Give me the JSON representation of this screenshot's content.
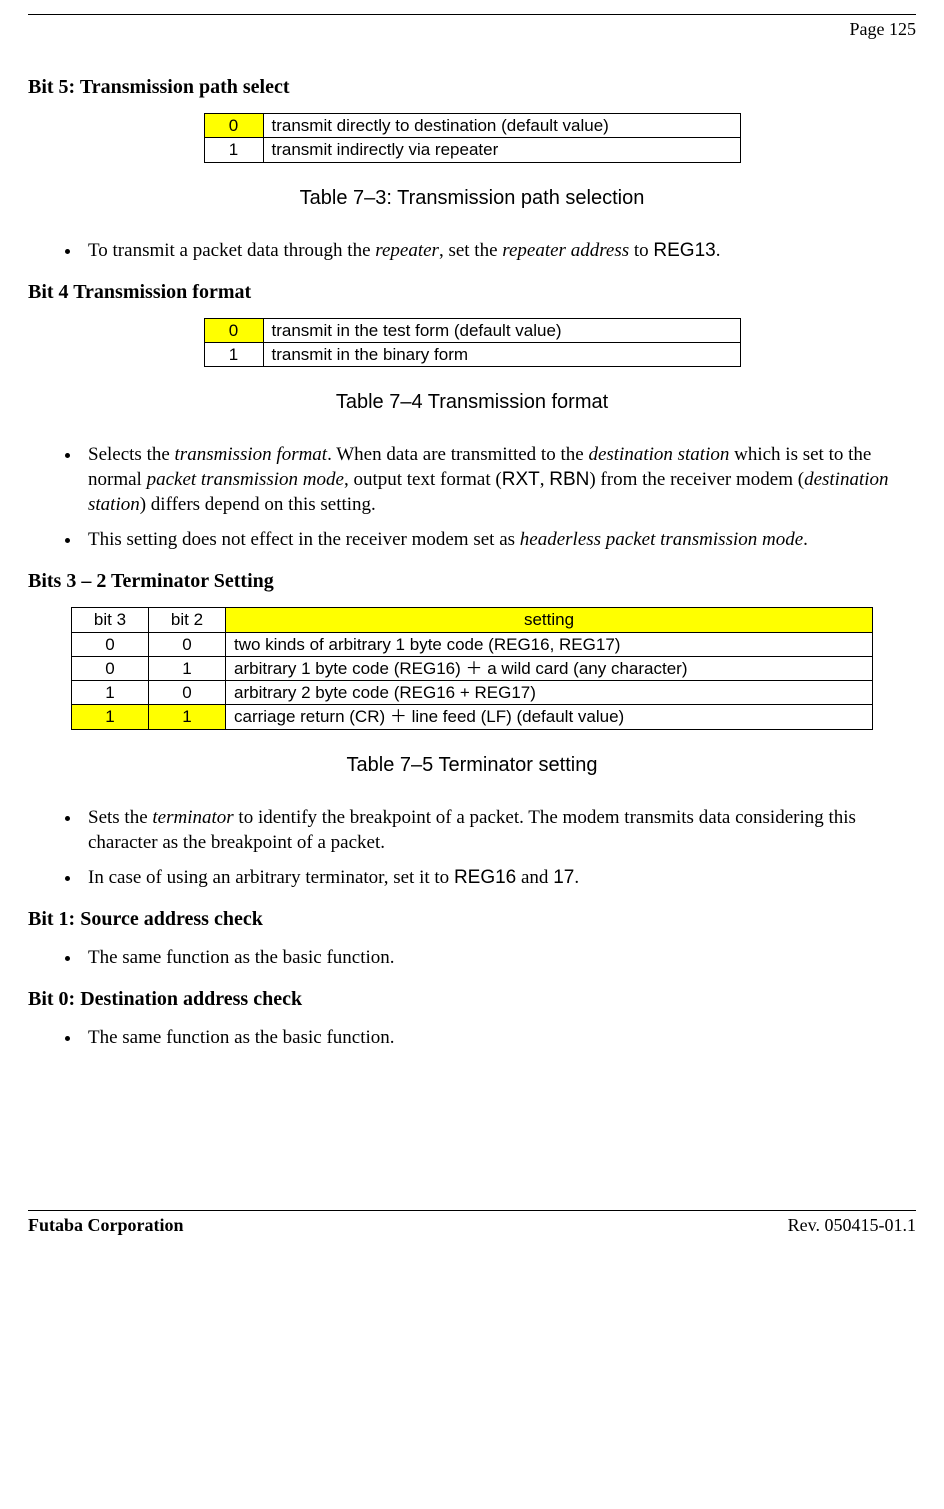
{
  "page_label": "Page  125",
  "bit5": {
    "heading": "Bit 5:  Transmission path select",
    "rows": [
      {
        "v": "0",
        "d": "transmit directly to destination  (default value)",
        "hl": true
      },
      {
        "v": "1",
        "d": "transmit indirectly via repeater",
        "hl": false
      }
    ],
    "caption": "Table 7–3:  Transmission path selection",
    "bullet_pre": "To transmit a packet data through the ",
    "bullet_rep": "repeater",
    "bullet_mid": ", set the ",
    "bullet_ra": "repeater address",
    "bullet_to": " to ",
    "bullet_reg": "REG13",
    "bullet_end": "."
  },
  "bit4": {
    "heading": "Bit 4  Transmission format",
    "rows": [
      {
        "v": "0",
        "d": "transmit  in the test form (default value)",
        "hl": true
      },
      {
        "v": "1",
        "d": "transmit in the binary form",
        "hl": false
      }
    ],
    "caption": "Table 7–4  Transmission format",
    "b1": {
      "t1": "Selects the ",
      "tf": "transmission format",
      "t2": ". When data are transmitted to the ",
      "ds": "destination station",
      "t3": " which is set to the normal ",
      "ptm": "packet transmission mode",
      "t4": ", output text format (",
      "rxt": "RXT",
      "t5": ", ",
      "rbn": "RBN",
      "t6": ") from the receiver modem (",
      "ds2": "destination station",
      "t7": ") differs depend on this setting."
    },
    "b2": {
      "t1": "This setting does not effect in the receiver modem set as ",
      "hptm": "headerless packet transmission mode",
      "t2": "."
    }
  },
  "bits32": {
    "heading": "Bits 3 – 2  Terminator Setting",
    "head": {
      "b3": "bit 3",
      "b2": "bit 2",
      "s": "setting"
    },
    "rows": [
      {
        "b3": "0",
        "b2": "0",
        "s": "two kinds of arbitrary 1 byte code (REG16, REG17)",
        "hl": false
      },
      {
        "b3": "0",
        "b2": "1",
        "s": "arbitrary 1 byte code (REG16) ＋ a wild card (any character)",
        "hl": false
      },
      {
        "b3": "1",
        "b2": "0",
        "s": "arbitrary 2 byte code (REG16 + REG17)",
        "hl": false
      },
      {
        "b3": "1",
        "b2": "1",
        "s": "carriage return (CR) ＋ line feed (LF) (default value)",
        "hl": true
      }
    ],
    "caption": "Table 7–5  Terminator setting",
    "b1": {
      "t1": "Sets the ",
      "term": "terminator",
      "t2": " to identify the breakpoint of a packet. The modem transmits data considering this character as the breakpoint of a packet."
    },
    "b2": {
      "t1": "In case of using an arbitrary terminator, set it to ",
      "r16": "REG16",
      "t2": " and ",
      "r17": "17",
      "t3": "."
    }
  },
  "bit1": {
    "heading": "Bit 1:  Source address check",
    "bullet": "The same function as the basic function."
  },
  "bit0": {
    "heading": "Bit 0:  Destination address check",
    "bullet": "The same function as the basic function."
  },
  "footer": {
    "left": "Futaba Corporation",
    "right": "Rev. 050415-01.1"
  }
}
